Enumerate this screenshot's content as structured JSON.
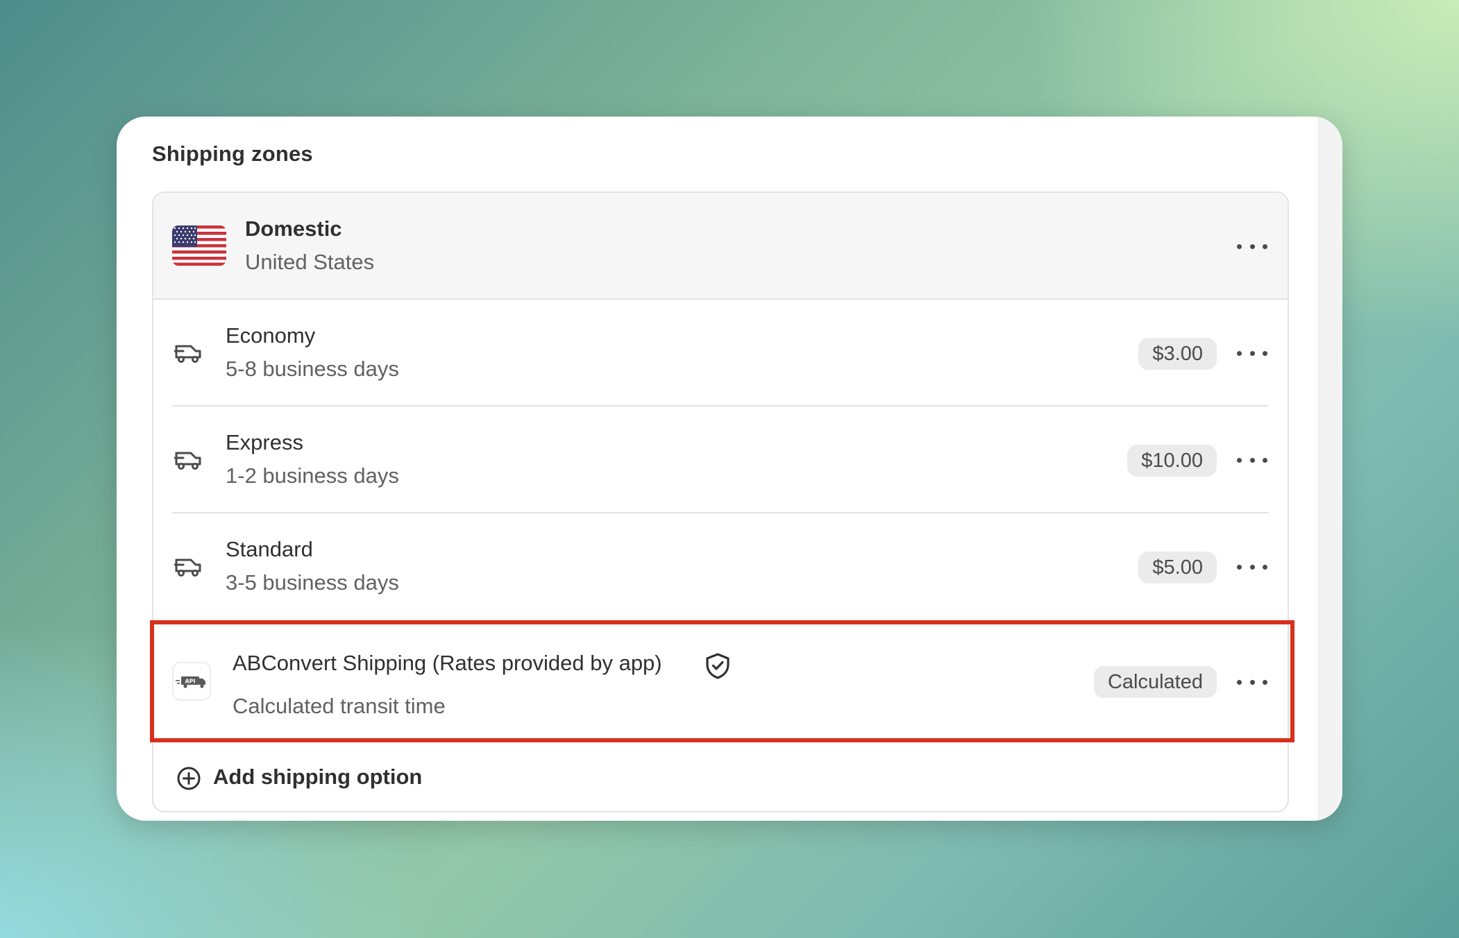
{
  "section": {
    "title": "Shipping zones"
  },
  "zone": {
    "name": "Domestic",
    "country": "United States",
    "flag_icon": "us-flag-icon"
  },
  "rates": [
    {
      "name": "Economy",
      "time": "5-8 business days",
      "price": "$3.00",
      "icon": "truck-icon"
    },
    {
      "name": "Express",
      "time": "1-2 business days",
      "price": "$10.00",
      "icon": "truck-icon"
    },
    {
      "name": "Standard",
      "time": "3-5 business days",
      "price": "$5.00",
      "icon": "truck-icon"
    }
  ],
  "app_rate": {
    "name": "ABConvert Shipping (Rates provided by app)",
    "time": "Calculated transit time",
    "price": "Calculated",
    "logo_icon": "api-truck-logo-icon",
    "badge_icon": "verified-shield-icon"
  },
  "add_option": {
    "label": "Add shipping option",
    "icon": "plus-circle-icon"
  },
  "colors": {
    "highlight": "#d8301c",
    "text_primary": "#303030",
    "text_secondary": "#616161",
    "badge_bg": "#ebebeb"
  }
}
